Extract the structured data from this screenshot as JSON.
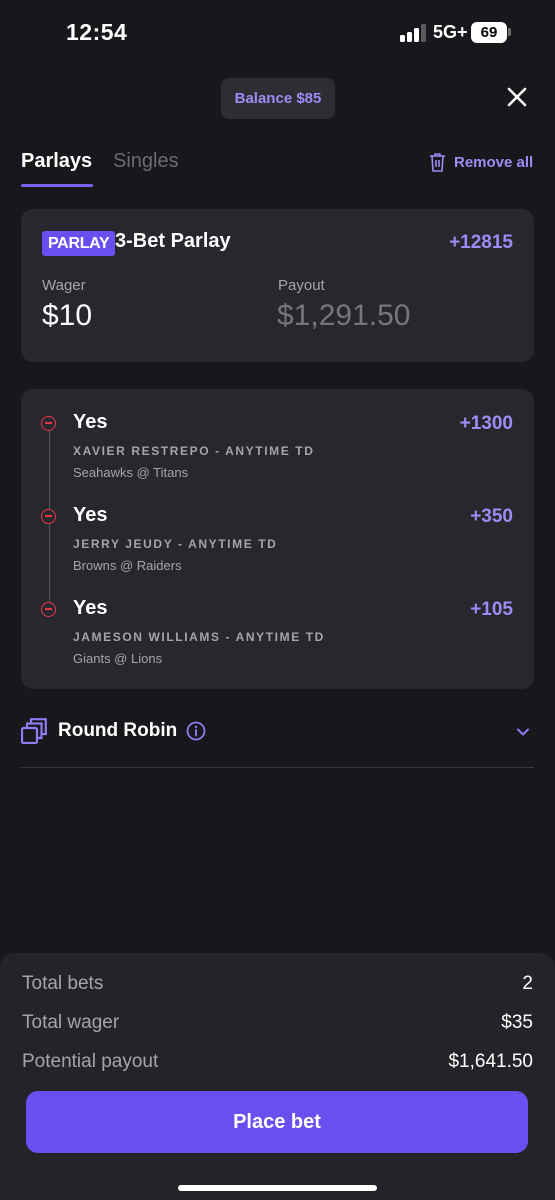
{
  "status_bar": {
    "time": "12:54",
    "network": "5G+",
    "battery": "69"
  },
  "header": {
    "balance": "Balance $85",
    "close_icon": "close-icon"
  },
  "tabs": [
    {
      "label": "Parlays",
      "active": true
    },
    {
      "label": "Singles",
      "active": false
    }
  ],
  "remove_all": {
    "label": "Remove all",
    "icon": "trash-icon"
  },
  "parlay": {
    "badge": "PARLAY",
    "title": "3-Bet Parlay",
    "odds": "+12815",
    "wager_label": "Wager",
    "wager_value": "$10",
    "payout_label": "Payout",
    "payout_value": "$1,291.50"
  },
  "legs": [
    {
      "pick": "Yes",
      "market": "XAVIER RESTREPO - ANYTIME TD",
      "game": "Seahawks @ Titans",
      "odds": "+1300"
    },
    {
      "pick": "Yes",
      "market": "JERRY JEUDY - ANYTIME TD",
      "game": "Browns @ Raiders",
      "odds": "+350"
    },
    {
      "pick": "Yes",
      "market": "JAMESON WILLIAMS - ANYTIME TD",
      "game": "Giants @ Lions",
      "odds": "+105"
    }
  ],
  "round_robin": {
    "label": "Round Robin",
    "icon": "round-robin-icon",
    "info_icon": "info-icon",
    "chevron_icon": "chevron-down-icon"
  },
  "summary": {
    "total_bets_label": "Total bets",
    "total_bets_value": "2",
    "total_wager_label": "Total wager",
    "total_wager_value": "$35",
    "potential_payout_label": "Potential payout",
    "potential_payout_value": "$1,641.50"
  },
  "place_bet": {
    "label": "Place bet"
  },
  "colors": {
    "background": "#18171b",
    "card": "#28272d",
    "accent": "#6a4ff0",
    "accent_text": "#9d8cf5",
    "remove_red": "#e8384f"
  }
}
